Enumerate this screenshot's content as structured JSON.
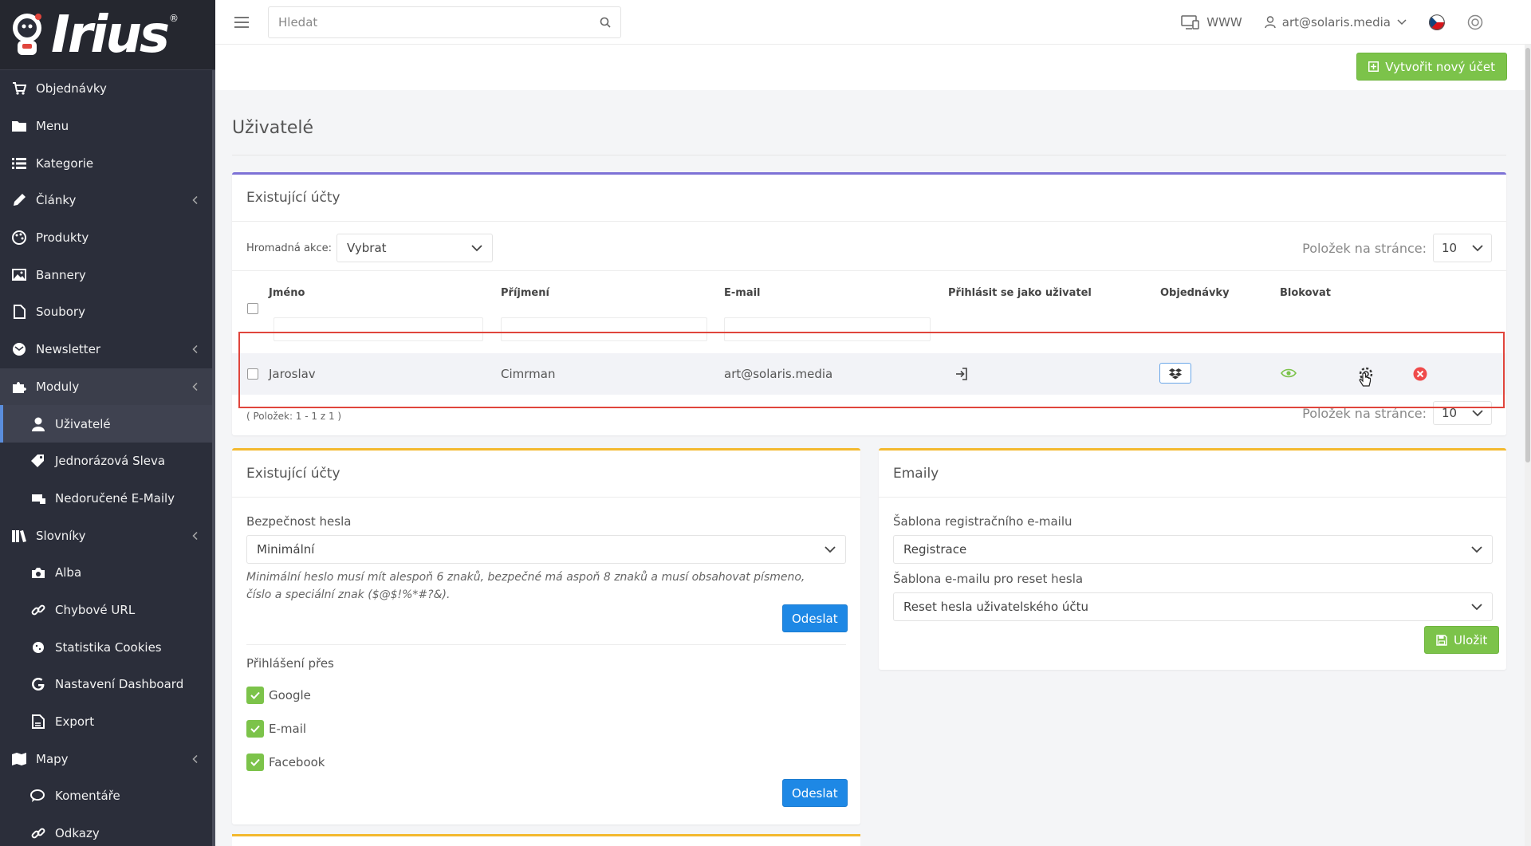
{
  "brand": {
    "logo_text": "Irius",
    "reg_mark": "®"
  },
  "sidebar": {
    "items": [
      {
        "label": "Objednávky",
        "icon": "cart-icon"
      },
      {
        "label": "Menu",
        "icon": "folder-icon"
      },
      {
        "label": "Kategorie",
        "icon": "list-icon"
      },
      {
        "label": "Články",
        "icon": "pencil-icon",
        "has_children": true
      },
      {
        "label": "Produkty",
        "icon": "palette-icon"
      },
      {
        "label": "Bannery",
        "icon": "image-icon"
      },
      {
        "label": "Soubory",
        "icon": "file-icon"
      },
      {
        "label": "Newsletter",
        "icon": "envelope-icon",
        "has_children": true
      },
      {
        "label": "Moduly",
        "icon": "puzzle-icon",
        "has_children": true,
        "expanded": true
      },
      {
        "label": "Uživatelé",
        "icon": "user-icon",
        "sub": true,
        "active": true
      },
      {
        "label": "Jednorázová Sleva",
        "icon": "tags-icon",
        "sub": true
      },
      {
        "label": "Nedoručené E-Maily",
        "icon": "mail-x-icon",
        "sub": true
      },
      {
        "label": "Slovníky",
        "icon": "books-icon",
        "has_children": true
      },
      {
        "label": "Alba",
        "icon": "camera-icon",
        "sub": true
      },
      {
        "label": "Chybové URL",
        "icon": "link-icon",
        "sub": true
      },
      {
        "label": "Statistika Cookies",
        "icon": "cookie-icon",
        "sub": true
      },
      {
        "label": "Nastavení Dashboard",
        "icon": "google-icon",
        "sub": true
      },
      {
        "label": "Export",
        "icon": "export-icon",
        "sub": true
      },
      {
        "label": "Mapy",
        "icon": "map-icon",
        "has_children": true
      },
      {
        "label": "Komentáře",
        "icon": "comments-icon",
        "sub": true
      },
      {
        "label": "Odkazy",
        "icon": "link-icon",
        "sub": true
      }
    ]
  },
  "topbar": {
    "search_placeholder": "Hledat",
    "www_label": "WWW",
    "user_email": "art@solaris.media"
  },
  "subheader": {
    "create_account_label": "Vytvořit nový účet"
  },
  "page": {
    "title": "Uživatelé"
  },
  "users_card": {
    "title": "Existující účty",
    "bulk_label": "Hromadná akce:",
    "bulk_value": "Vybrat",
    "per_page_label": "Položek na stránce:",
    "per_page_value": "10",
    "columns": {
      "first_name": "Jméno",
      "last_name": "Příjmení",
      "email": "E-mail",
      "login_as": "Přihlásit se jako uživatel",
      "orders": "Objednávky",
      "block": "Blokovat"
    },
    "rows": [
      {
        "first_name": "Jaroslav",
        "last_name": "Cimrman",
        "email": "art@solaris.media"
      }
    ],
    "pager_info": "( Položek: 1 - 1 z 1 )"
  },
  "security_card": {
    "title": "Existující účty",
    "password_label": "Bezpečnost hesla",
    "password_value": "Minimální",
    "note": "Minimální heslo musí mít alespoň 6 znaků, bezpečné má aspoň 8 znaků a musí obsahovat písmeno, číslo a speciální znak ($@$!%*#?&).",
    "submit_label": "Odeslat",
    "login_via_label": "Přihlášení přes",
    "providers": [
      "Google",
      "E-mail",
      "Facebook"
    ],
    "submit2_label": "Odeslat"
  },
  "email_card": {
    "title": "Emaily",
    "reg_template_label": "Šablona registračního e-mailu",
    "reg_template_value": "Registrace",
    "reset_template_label": "Šablona e-mailu pro reset hesla",
    "reset_template_value": "Reset hesla uživatelského účtu",
    "save_label": "Uložit"
  },
  "colors": {
    "sidebar_bg": "#2b2e3a",
    "accent_purple": "#7d72d6",
    "accent_yellow": "#f3b92f",
    "button_green": "#7cc34a",
    "button_blue": "#1e88e5",
    "highlight_red": "#e0453c"
  }
}
